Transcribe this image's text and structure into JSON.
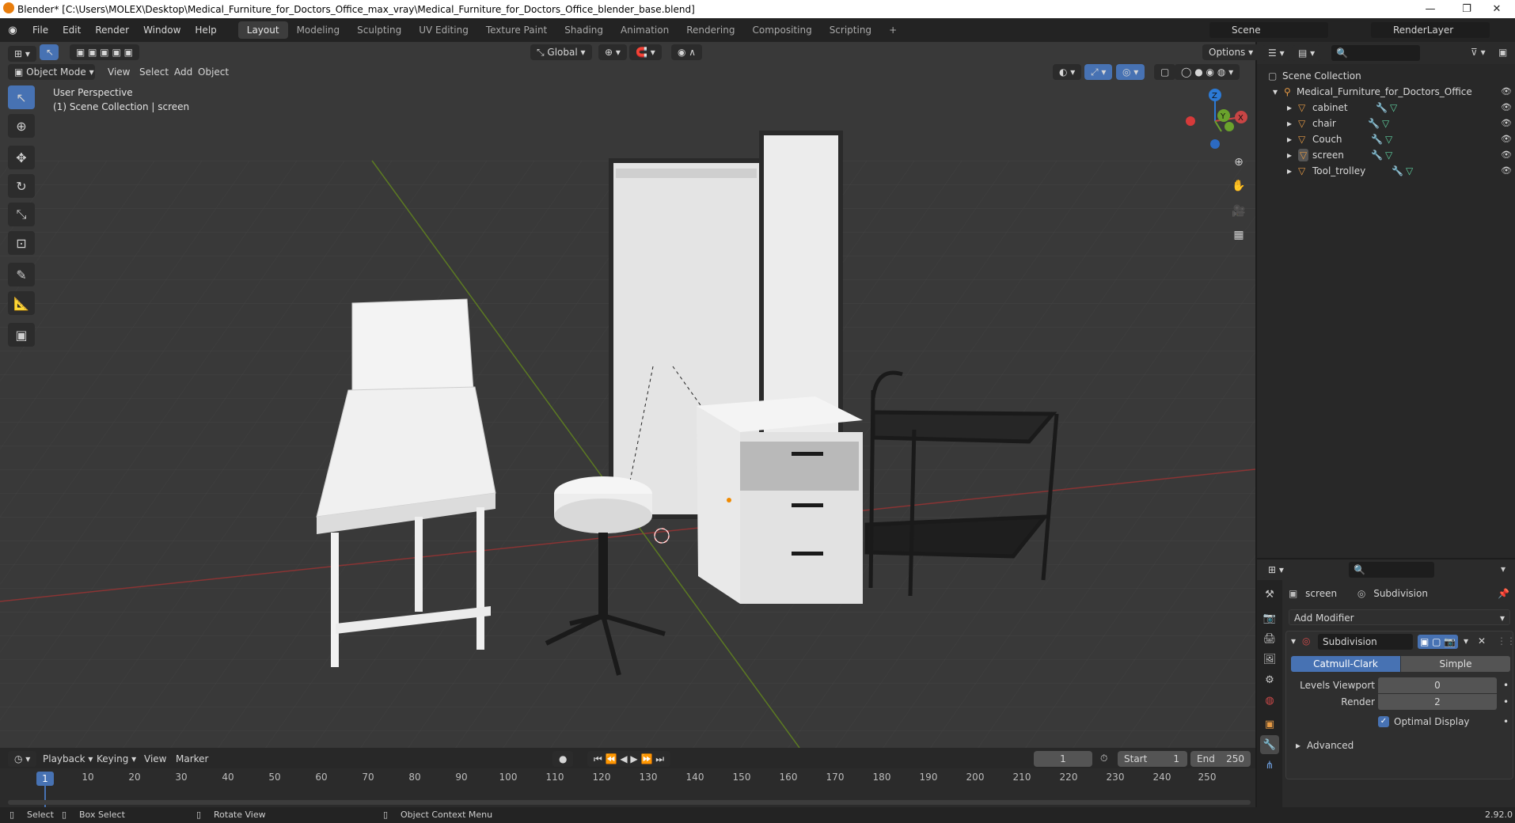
{
  "window": {
    "title": "Blender* [C:\\Users\\MOLEX\\Desktop\\Medical_Furniture_for_Doctors_Office_max_vray\\Medical_Furniture_for_Doctors_Office_blender_base.blend]",
    "minimize": "—",
    "maximize": "❐",
    "close": "✕"
  },
  "menu": [
    "File",
    "Edit",
    "Render",
    "Window",
    "Help"
  ],
  "workspaces": [
    "Layout",
    "Modeling",
    "Sculpting",
    "UV Editing",
    "Texture Paint",
    "Shading",
    "Animation",
    "Rendering",
    "Compositing",
    "Scripting"
  ],
  "active_workspace": "Layout",
  "add_workspace": "+",
  "scene": {
    "name": "Scene",
    "render_layer": "RenderLayer"
  },
  "viewport_header": {
    "mode": "Object Mode",
    "menus": [
      "View",
      "Select",
      "Add",
      "Object"
    ],
    "transform": "Global",
    "options": "Options"
  },
  "viewport": {
    "perspective": "User Perspective",
    "collection_info": "(1) Scene Collection | screen"
  },
  "gizmo": {
    "x": "X",
    "y": "Y",
    "z": "Z"
  },
  "outliner": {
    "root": "Scene Collection",
    "collection": "Medical_Furniture_for_Doctors_Office",
    "objects": [
      "cabinet",
      "chair",
      "Couch",
      "screen",
      "Tool_trolley"
    ]
  },
  "properties": {
    "object": "screen",
    "modifier_name": "Subdivision",
    "add_modifier": "Add Modifier",
    "modifier_header": "Subdivision",
    "types": [
      "Catmull-Clark",
      "Simple"
    ],
    "active_type": "Catmull-Clark",
    "levels_viewport_label": "Levels Viewport",
    "levels_viewport": "0",
    "render_label": "Render",
    "render": "2",
    "optimal_display": "Optimal Display",
    "advanced": "Advanced"
  },
  "timeline": {
    "menus": [
      "Playback",
      "Keying",
      "View",
      "Marker"
    ],
    "current_frame": "1",
    "start_label": "Start",
    "start": "1",
    "end_label": "End",
    "end": "250",
    "ticks": [
      "1",
      "10",
      "20",
      "30",
      "40",
      "50",
      "60",
      "70",
      "80",
      "90",
      "100",
      "110",
      "120",
      "130",
      "140",
      "150",
      "160",
      "170",
      "180",
      "190",
      "200",
      "210",
      "220",
      "230",
      "240",
      "250"
    ]
  },
  "status": {
    "select": "Select",
    "box_select": "Box Select",
    "rotate_view": "Rotate View",
    "context_menu": "Object Context Menu",
    "version": "2.92.0"
  }
}
